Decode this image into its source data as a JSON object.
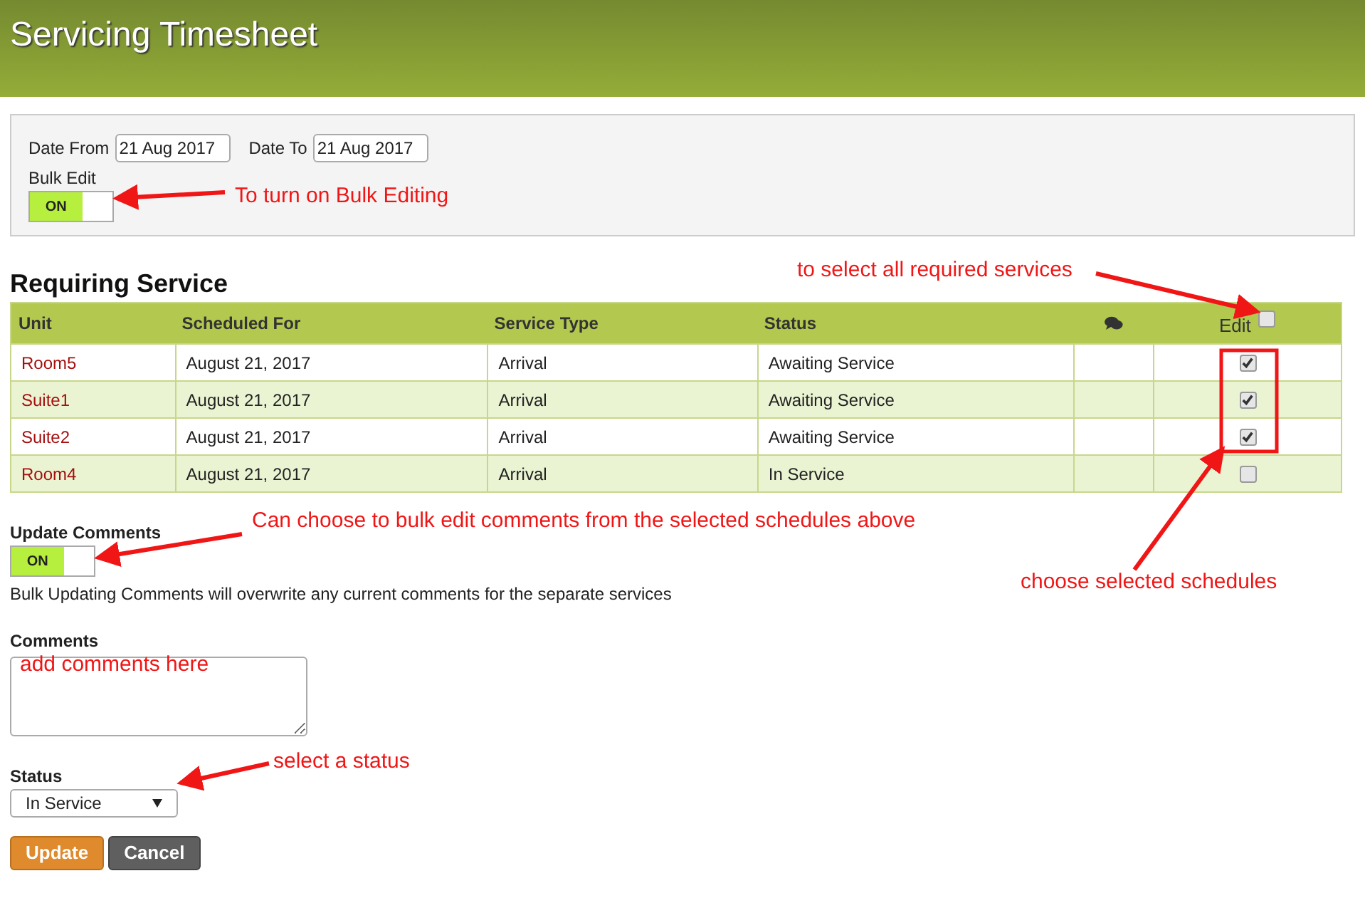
{
  "header": {
    "title": "Servicing Timesheet"
  },
  "filters": {
    "date_from": {
      "label": "Date From",
      "value": "21 Aug 2017"
    },
    "date_to": {
      "label": "Date To",
      "value": "21 Aug 2017"
    },
    "bulk_edit": {
      "label": "Bulk Edit",
      "on": true,
      "on_text": "ON"
    }
  },
  "section_title": "Requiring Service",
  "table": {
    "columns": [
      "Unit",
      "Scheduled For",
      "Service Type",
      "Status",
      "",
      "Edit"
    ],
    "select_all_checked": false,
    "rows": [
      {
        "unit": "Room5",
        "scheduled": "August 21, 2017",
        "service_type": "Arrival",
        "status": "Awaiting Service",
        "checked": true
      },
      {
        "unit": "Suite1",
        "scheduled": "August 21, 2017",
        "service_type": "Arrival",
        "status": "Awaiting Service",
        "checked": true
      },
      {
        "unit": "Suite2",
        "scheduled": "August 21, 2017",
        "service_type": "Arrival",
        "status": "Awaiting Service",
        "checked": true
      },
      {
        "unit": "Room4",
        "scheduled": "August 21, 2017",
        "service_type": "Arrival",
        "status": "In Service",
        "checked": false
      }
    ]
  },
  "update_comments": {
    "label": "Update Comments",
    "on": true,
    "on_text": "ON",
    "note": "Bulk Updating Comments will overwrite any current comments for the separate services"
  },
  "comments": {
    "label": "Comments"
  },
  "status": {
    "label": "Status",
    "value": "In Service"
  },
  "buttons": [
    {
      "label": "Update",
      "kind": "primary"
    },
    {
      "label": "Cancel",
      "kind": "secondary"
    }
  ],
  "annotations": [
    {
      "text": "To turn on Bulk Editing"
    },
    {
      "text": "to select all required services"
    },
    {
      "text": "Can choose to bulk edit comments from the selected schedules above"
    },
    {
      "text": "choose selected schedules"
    },
    {
      "text": "add comments here"
    },
    {
      "text": "select a status"
    }
  ]
}
